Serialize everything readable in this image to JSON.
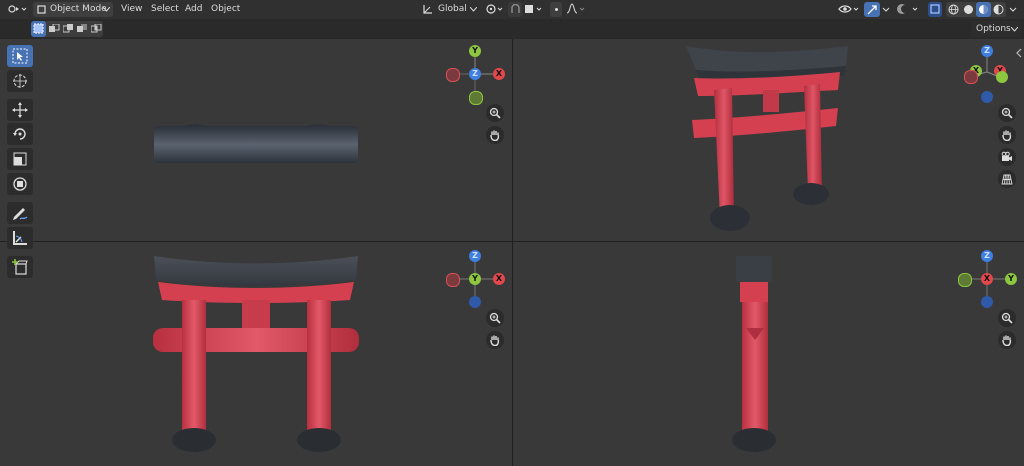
{
  "header": {
    "mode_label": "Object Mode",
    "menus": [
      "View",
      "Select",
      "Add",
      "Object"
    ],
    "transform_orientation": "Global",
    "options_label": "Options"
  },
  "axes": {
    "x": "X",
    "y": "Y",
    "z": "Z"
  },
  "colors": {
    "x_axis": "#e2484b",
    "y_axis": "#8dc63f",
    "z_axis": "#3f7fe0",
    "active_tool": "#4772b3",
    "torii_red": "#d44050",
    "torii_dark": "#444a52"
  },
  "viewports": [
    "top",
    "user-perspective",
    "front",
    "right"
  ]
}
